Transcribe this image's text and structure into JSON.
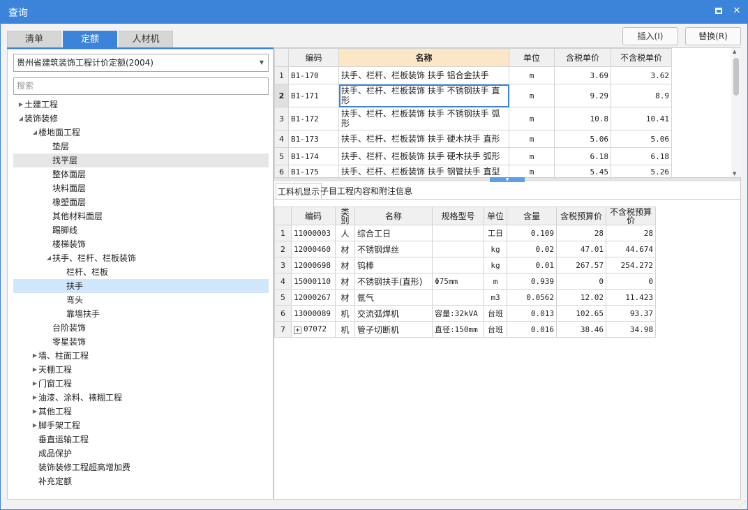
{
  "window": {
    "title": "查询"
  },
  "tabs": [
    {
      "label": "清单"
    },
    {
      "label": "定额"
    },
    {
      "label": "人材机"
    }
  ],
  "buttons": {
    "insert": "插入(I)",
    "replace": "替换(R)"
  },
  "left": {
    "select_value": "贵州省建筑装饰工程计价定额(2004)",
    "search_placeholder": "搜索",
    "tree": [
      {
        "label": "土建工程",
        "level": 0,
        "toggle": "▶"
      },
      {
        "label": "装饰装修",
        "level": 0,
        "toggle": "◢"
      },
      {
        "label": "楼地面工程",
        "level": 1,
        "toggle": "◢"
      },
      {
        "label": "垫层",
        "level": 2,
        "toggle": ""
      },
      {
        "label": "找平层",
        "level": 2,
        "toggle": ""
      },
      {
        "label": "整体面层",
        "level": 2,
        "toggle": ""
      },
      {
        "label": "块料面层",
        "level": 2,
        "toggle": ""
      },
      {
        "label": "橡塑面层",
        "level": 2,
        "toggle": ""
      },
      {
        "label": "其他材料面层",
        "level": 2,
        "toggle": ""
      },
      {
        "label": "踢脚线",
        "level": 2,
        "toggle": ""
      },
      {
        "label": "楼梯装饰",
        "level": 2,
        "toggle": ""
      },
      {
        "label": "扶手、栏杆、栏板装饰",
        "level": 2,
        "toggle": "◢"
      },
      {
        "label": "栏杆、栏板",
        "level": 3,
        "toggle": ""
      },
      {
        "label": "扶手",
        "level": 3,
        "toggle": ""
      },
      {
        "label": "弯头",
        "level": 3,
        "toggle": ""
      },
      {
        "label": "靠墙扶手",
        "level": 3,
        "toggle": ""
      },
      {
        "label": "台阶装饰",
        "level": 2,
        "toggle": ""
      },
      {
        "label": "零星装饰",
        "level": 2,
        "toggle": ""
      },
      {
        "label": "墙、柱面工程",
        "level": 1,
        "toggle": "▶"
      },
      {
        "label": "天棚工程",
        "level": 1,
        "toggle": "▶"
      },
      {
        "label": "门窗工程",
        "level": 1,
        "toggle": "▶"
      },
      {
        "label": "油漆、涂料、裱糊工程",
        "level": 1,
        "toggle": "▶"
      },
      {
        "label": "其他工程",
        "level": 1,
        "toggle": "▶"
      },
      {
        "label": "脚手架工程",
        "level": 1,
        "toggle": "▶"
      },
      {
        "label": "垂直运输工程",
        "level": 1,
        "toggle": ""
      },
      {
        "label": "成品保护",
        "level": 1,
        "toggle": ""
      },
      {
        "label": "装饰装修工程超高增加费",
        "level": 1,
        "toggle": ""
      },
      {
        "label": "补充定额",
        "level": 1,
        "toggle": ""
      }
    ]
  },
  "upper": {
    "headers": [
      "",
      "编码",
      "名称",
      "单位",
      "含税单价",
      "不含税单价"
    ],
    "rows": [
      {
        "n": "1",
        "code": "B1-170",
        "name": "扶手、栏杆、栏板装饰 扶手 铝合金扶手",
        "unit": "m",
        "tax_price": "3.69",
        "notax_price": "3.62"
      },
      {
        "n": "2",
        "code": "B1-171",
        "name": "扶手、栏杆、栏板装饰 扶手 不锈钢扶手 直形",
        "unit": "m",
        "tax_price": "9.29",
        "notax_price": "8.9"
      },
      {
        "n": "3",
        "code": "B1-172",
        "name": "扶手、栏杆、栏板装饰 扶手 不锈钢扶手 弧形",
        "unit": "m",
        "tax_price": "10.8",
        "notax_price": "10.41"
      },
      {
        "n": "4",
        "code": "B1-173",
        "name": "扶手、栏杆、栏板装饰 扶手 硬木扶手 直形",
        "unit": "m",
        "tax_price": "5.06",
        "notax_price": "5.06"
      },
      {
        "n": "5",
        "code": "B1-174",
        "name": "扶手、栏杆、栏板装饰 扶手 硬木扶手 弧形",
        "unit": "m",
        "tax_price": "6.18",
        "notax_price": "6.18"
      },
      {
        "n": "6",
        "code": "B1-175",
        "name": "扶手、栏杆、栏板装饰 扶手 钢管扶手 直型",
        "unit": "m",
        "tax_price": "5.45",
        "notax_price": "5.26"
      }
    ]
  },
  "subtabs": [
    "工料机显示",
    "子目工程内容和附注信息"
  ],
  "lower": {
    "headers": [
      "",
      "编码",
      "类别",
      "名称",
      "规格型号",
      "单位",
      "含量",
      "含税预算价",
      "不含税预算价"
    ],
    "rows": [
      {
        "n": "1",
        "code": "11000003",
        "type": "人",
        "name": "综合工日",
        "spec": "",
        "unit": "工日",
        "qty": "0.109",
        "tax": "28",
        "notax": "28"
      },
      {
        "n": "2",
        "code": "12000460",
        "type": "材",
        "name": "不锈钢焊丝",
        "spec": "",
        "unit": "kg",
        "qty": "0.02",
        "tax": "47.01",
        "notax": "44.674"
      },
      {
        "n": "3",
        "code": "12000698",
        "type": "材",
        "name": "钨棒",
        "spec": "",
        "unit": "kg",
        "qty": "0.01",
        "tax": "267.57",
        "notax": "254.272"
      },
      {
        "n": "4",
        "code": "15000110",
        "type": "材",
        "name": "不锈钢扶手(直形)",
        "spec": "Φ75mm",
        "unit": "m",
        "qty": "0.939",
        "tax": "0",
        "notax": "0"
      },
      {
        "n": "5",
        "code": "12000267",
        "type": "材",
        "name": "氩气",
        "spec": "",
        "unit": "m3",
        "qty": "0.0562",
        "tax": "12.02",
        "notax": "11.423"
      },
      {
        "n": "6",
        "code": "13000089",
        "type": "机",
        "name": "交流弧焊机",
        "spec": "容量:32kVA",
        "unit": "台班",
        "qty": "0.013",
        "tax": "102.65",
        "notax": "93.37"
      },
      {
        "n": "7",
        "code": "07072",
        "type": "机",
        "name": "管子切断机",
        "spec": "直径:150mm",
        "unit": "台班",
        "qty": "0.016",
        "tax": "38.46",
        "notax": "34.98"
      }
    ]
  }
}
